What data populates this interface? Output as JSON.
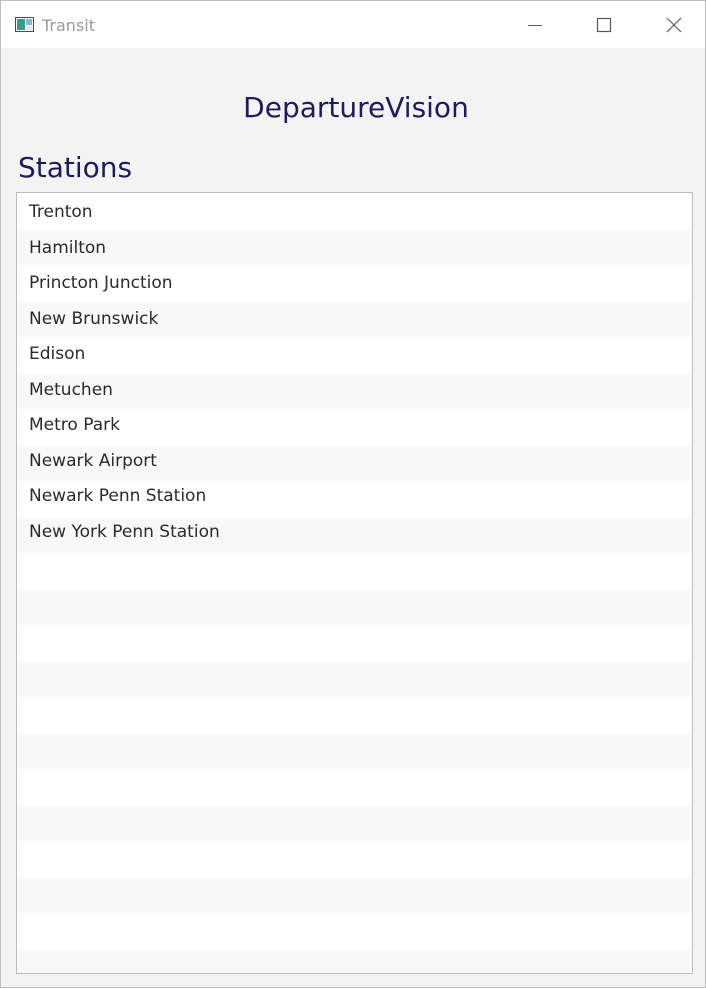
{
  "window": {
    "title": "Transit"
  },
  "header": {
    "title": "DepartureVision"
  },
  "stations": {
    "heading": "Stations",
    "items": [
      "Trenton",
      "Hamilton",
      "Princton Junction",
      "New Brunswick",
      "Edison",
      "Metuchen",
      "Metro Park",
      "Newark Airport",
      "Newark Penn Station",
      "New York Penn Station"
    ]
  },
  "colors": {
    "heading": "#1f1a5e",
    "window_background": "#f3f3f3",
    "row_alternate": "#f8f8f8"
  }
}
